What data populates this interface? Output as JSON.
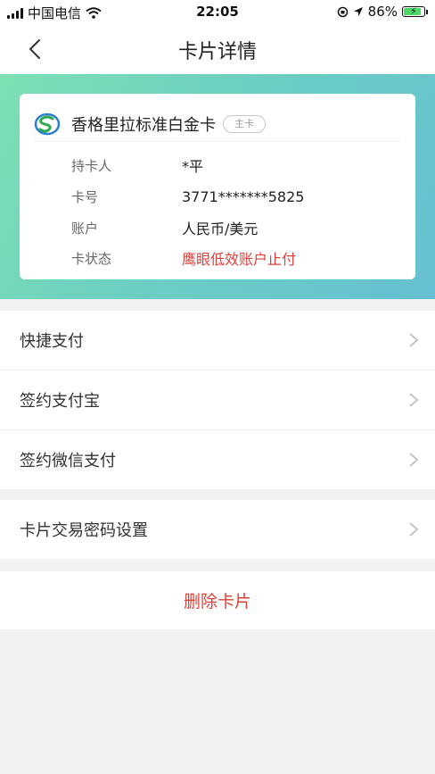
{
  "status_bar": {
    "carrier": "中国电信",
    "time": "22:05",
    "battery": "86%"
  },
  "nav": {
    "title": "卡片详情"
  },
  "card": {
    "name": "香格里拉标准白金卡",
    "tag": "主卡",
    "rows": [
      {
        "label": "持卡人",
        "value": "*平"
      },
      {
        "label": "卡号",
        "value": "3771*******5825"
      },
      {
        "label": "账户",
        "value": "人民币/美元"
      },
      {
        "label": "卡状态",
        "value": "鹰眼低效账户止付"
      }
    ],
    "colors": {
      "status": "#e0403a",
      "gradient_start": "#7ee0b3",
      "gradient_end": "#66bfd3"
    }
  },
  "menu": {
    "group1": [
      "快捷支付",
      "签约支付宝",
      "签约微信支付"
    ],
    "group2": [
      "卡片交易密码设置"
    ]
  },
  "delete": {
    "label": "删除卡片"
  }
}
